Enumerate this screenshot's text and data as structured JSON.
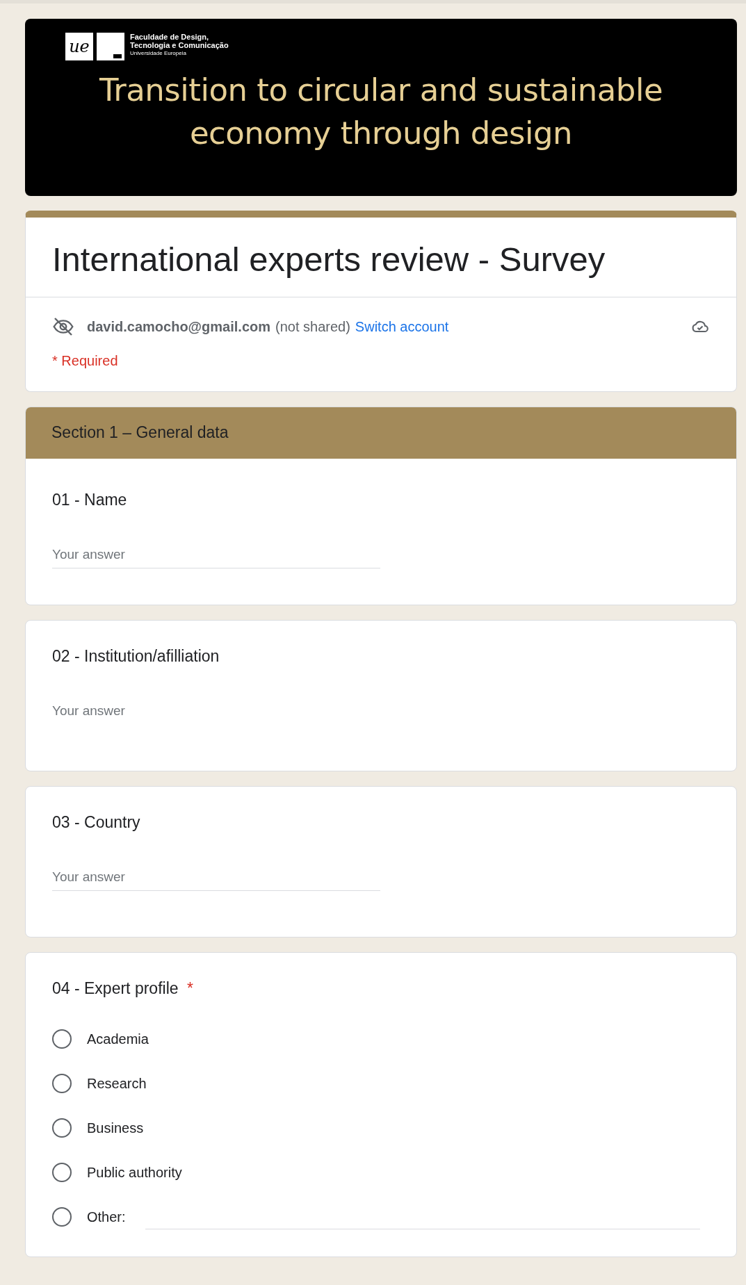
{
  "banner": {
    "logo_mark": "ue",
    "logo_lines": [
      "Faculdade de Design,",
      "Tecnologia e Comunicação",
      "Universidade Europeia"
    ],
    "title": "Transition to circular and sustainable economy through design"
  },
  "form": {
    "title": "International experts review - Survey",
    "account": {
      "email": "david.camocho@gmail.com",
      "note": "(not shared)",
      "switch_link": "Switch account"
    },
    "required_note": "* Required"
  },
  "section": {
    "title": "Section 1 – General data"
  },
  "questions": [
    {
      "kind": "text",
      "title": "01 - Name",
      "placeholder": "Your answer",
      "underlined": true
    },
    {
      "kind": "text",
      "title": "02 - Institution/afilliation",
      "placeholder": "Your answer",
      "underlined": false
    },
    {
      "kind": "text",
      "title": "03 - Country",
      "placeholder": "Your answer",
      "underlined": true
    },
    {
      "kind": "choice",
      "title": "04 - Expert profile",
      "required_mark": "*",
      "options": [
        {
          "label": "Academia",
          "selected": false,
          "kind": "plain"
        },
        {
          "label": "Research",
          "selected": false,
          "kind": "plain"
        },
        {
          "label": "Business",
          "selected": false,
          "kind": "plain"
        },
        {
          "label": "Public authority",
          "selected": false,
          "kind": "plain"
        },
        {
          "label": "Other:",
          "selected": false,
          "kind": "other"
        }
      ]
    }
  ]
}
